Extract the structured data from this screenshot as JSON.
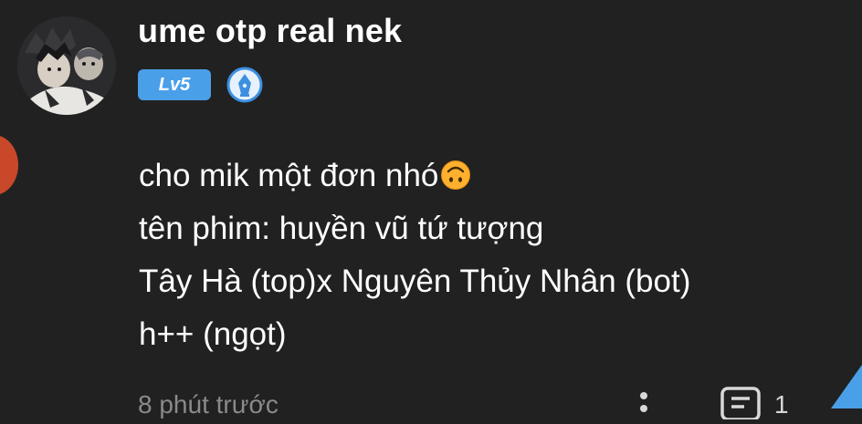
{
  "comment": {
    "username": "ume otp real nek",
    "level_badge": "Lv5",
    "badges": {
      "level_color": "#4a9fe9",
      "pen_badge_icon": "fountain-pen-icon"
    },
    "lines": [
      "cho mik một đơn nhó",
      "tên phim: huyền vũ tứ tượng",
      "Tây Hà (top)x Nguyên Thủy Nhân (bot)",
      "h++ (ngọt)"
    ],
    "emoji": "upside-down-face-emoji",
    "timestamp": "8 phút trước",
    "reply_count": "1"
  },
  "colors": {
    "background": "#212121",
    "text": "#ffffff",
    "muted_text": "#8a8a8a",
    "accent_blue": "#4a9fe9"
  }
}
